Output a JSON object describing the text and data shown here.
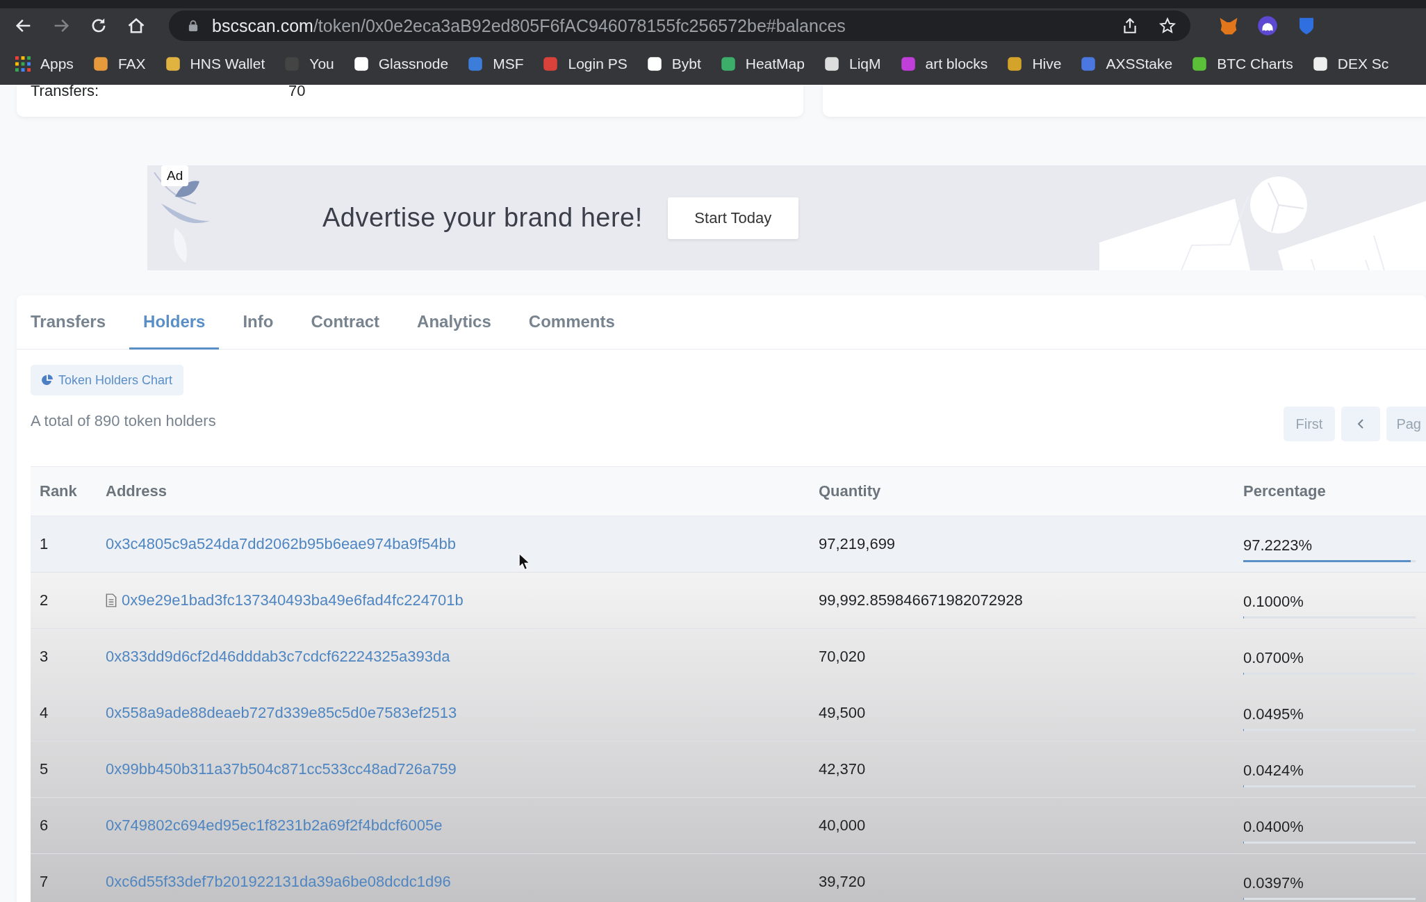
{
  "browser": {
    "url": {
      "domain": "bscscan.com",
      "path": "/token/0x0e2eca3aB92ed805F6fAC946078155fc256572be#balances"
    },
    "bookmarks": [
      {
        "label": "Apps",
        "kind": "apps"
      },
      {
        "label": "FAX",
        "kind": "site"
      },
      {
        "label": "HNS Wallet",
        "kind": "site"
      },
      {
        "label": "You",
        "kind": "site"
      },
      {
        "label": "Glassnode",
        "kind": "site"
      },
      {
        "label": "MSF",
        "kind": "site"
      },
      {
        "label": "Login PS",
        "kind": "site"
      },
      {
        "label": "Bybt",
        "kind": "site"
      },
      {
        "label": "HeatMap",
        "kind": "site"
      },
      {
        "label": "LiqM",
        "kind": "site"
      },
      {
        "label": "art blocks",
        "kind": "site"
      },
      {
        "label": "Hive",
        "kind": "site"
      },
      {
        "label": "AXSStake",
        "kind": "site"
      },
      {
        "label": "BTC Charts",
        "kind": "site"
      },
      {
        "label": "DEX Sc",
        "kind": "site"
      }
    ]
  },
  "summary": {
    "label": "Transfers:",
    "value": "70"
  },
  "ad": {
    "badge": "Ad",
    "headline": "Advertise your brand here!",
    "button": "Start Today"
  },
  "tabs": [
    {
      "label": "Transfers",
      "selected": false
    },
    {
      "label": "Holders",
      "selected": true
    },
    {
      "label": "Info",
      "selected": false
    },
    {
      "label": "Contract",
      "selected": false
    },
    {
      "label": "Analytics",
      "selected": false
    },
    {
      "label": "Comments",
      "selected": false
    }
  ],
  "chart_button": "Token Holders Chart",
  "total": "A total of 890 token holders",
  "pagination": [
    {
      "kind": "text",
      "label": "First"
    },
    {
      "kind": "prev"
    },
    {
      "kind": "text",
      "label": "Pag"
    }
  ],
  "table": {
    "columns": [
      "Rank",
      "Address",
      "Quantity",
      "Percentage"
    ],
    "rows": [
      {
        "rank": "1",
        "address": "0x3c4805c9a524da7dd2062b95b6eae974ba9f54bb",
        "contract": false,
        "quantity": "97,219,699",
        "percentage": "97.2223%",
        "level": 0.9722,
        "hovered": true
      },
      {
        "rank": "2",
        "address": "0x9e29e1bad3fc137340493ba49e6fad4fc224701b",
        "contract": true,
        "quantity": "99,992.859846671982072928",
        "percentage": "0.1000%",
        "level": 0.001,
        "hovered": false
      },
      {
        "rank": "3",
        "address": "0x833dd9d6cf2d46dddab3c7cdcf62224325a393da",
        "contract": false,
        "quantity": "70,020",
        "percentage": "0.0700%",
        "level": 0.0007,
        "hovered": false
      },
      {
        "rank": "4",
        "address": "0x558a9ade88deaeb727d339e85c5d0e7583ef2513",
        "contract": false,
        "quantity": "49,500",
        "percentage": "0.0495%",
        "level": 0.0005,
        "hovered": false
      },
      {
        "rank": "5",
        "address": "0x99bb450b311a37b504c871cc533cc48ad726a759",
        "contract": false,
        "quantity": "42,370",
        "percentage": "0.0424%",
        "level": 0.0004,
        "hovered": false
      },
      {
        "rank": "6",
        "address": "0x749802c694ed95ec1f8231b2a69f2f4bdcf6005e",
        "contract": false,
        "quantity": "40,000",
        "percentage": "0.0400%",
        "level": 0.0004,
        "hovered": false
      },
      {
        "rank": "7",
        "address": "0xc6d55f33def7b201922131da39a6be08dcdc1d96",
        "contract": false,
        "quantity": "39,720",
        "percentage": "0.0397%",
        "level": 0.0004,
        "hovered": false
      }
    ]
  }
}
